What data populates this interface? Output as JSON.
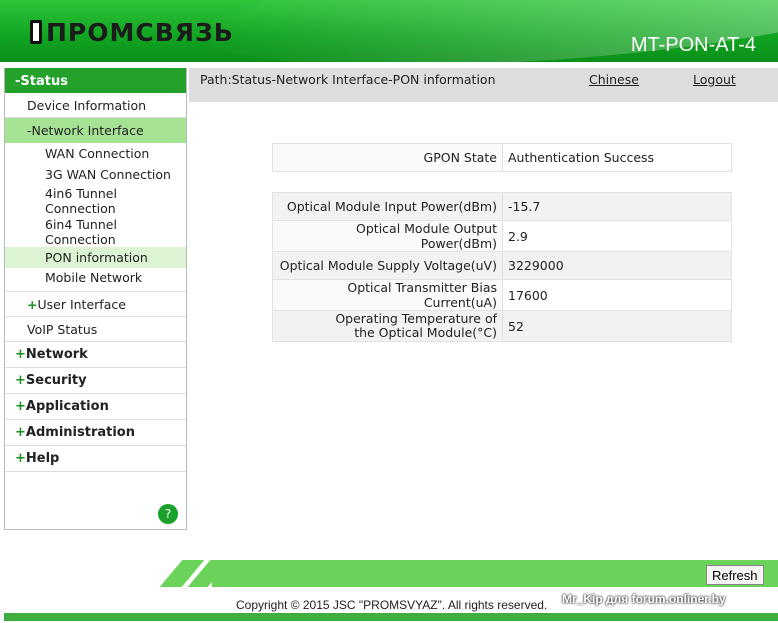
{
  "header": {
    "logo": "ПРОМСВЯЗЬ",
    "model": "MT-PON-AT-4"
  },
  "sidebar": {
    "status": "-Status",
    "device_info": "Device Information",
    "network_interface": "-Network Interface",
    "sub": [
      "WAN Connection",
      "3G WAN Connection",
      "4in6 Tunnel Connection",
      "6in4 Tunnel Connection",
      "PON information",
      "Mobile Network"
    ],
    "user_interface": "User Interface",
    "voip": "VoIP Status",
    "top": [
      "Network",
      "Security",
      "Application",
      "Administration",
      "Help"
    ],
    "plus": "+",
    "help": "?"
  },
  "pathbar": {
    "path": "Path:Status-Network Interface-PON information",
    "chinese": "Chinese",
    "logout": "Logout"
  },
  "gpon": {
    "label": "GPON State",
    "value": "Authentication Success"
  },
  "optical": [
    {
      "label": "Optical Module Input Power(dBm)",
      "value": "-15.7"
    },
    {
      "label": "Optical Module Output Power(dBm)",
      "value": "2.9"
    },
    {
      "label": "Optical Module Supply Voltage(uV)",
      "value": "3229000"
    },
    {
      "label": "Optical Transmitter Bias Current(uA)",
      "value": "17600"
    },
    {
      "label": "Operating Temperature of the Optical Module(°C)",
      "value": "52"
    }
  ],
  "footer": {
    "refresh": "Refresh",
    "copyright": "Copyright © 2015 JSC \"PROMSVYAZ\". All rights reserved.",
    "watermark": "Mr_Kip для forum.onliner.by"
  }
}
